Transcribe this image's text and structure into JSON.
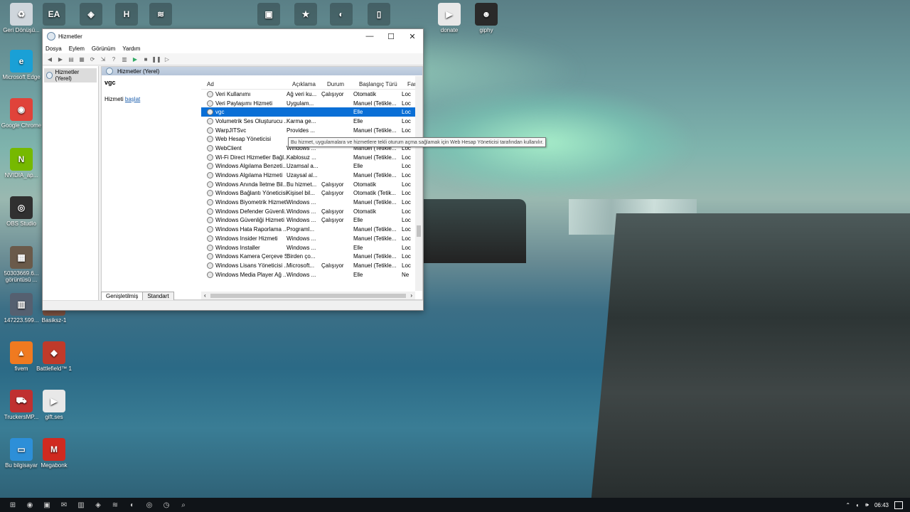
{
  "desktop": {
    "icons": [
      {
        "label": "Geri Dönüşü...",
        "glyph": "♻",
        "color": "#cfd6dc"
      },
      {
        "label": "Microsoft Edge",
        "glyph": "e",
        "color": "#1aa0d6"
      },
      {
        "label": "Google Chrome",
        "glyph": "◉",
        "color": "#e0433a"
      },
      {
        "label": "NVIDIA_ap...",
        "glyph": "N",
        "color": "#76b900"
      },
      {
        "label": "OBS Studio",
        "glyph": "◎",
        "color": "#303030"
      },
      {
        "label": "50303669.6... görüntüsü ...",
        "glyph": "▦",
        "color": "#6a5a4a"
      },
      {
        "label": "147223.599...",
        "glyph": "▥",
        "color": "#556070"
      },
      {
        "label": "fivem",
        "glyph": "▲",
        "color": "#f07a20"
      },
      {
        "label": "TruckersMP...",
        "glyph": "⛟",
        "color": "#c03030"
      },
      {
        "label": "Bu bilgisayar",
        "glyph": "▭",
        "color": "#2d8fd8"
      },
      {
        "label": "Basiksz-1",
        "glyph": "▣",
        "color": "#7a5040"
      },
      {
        "label": "Battlefield™ 1",
        "glyph": "◆",
        "color": "#c03a2a"
      },
      {
        "label": "gift.ses",
        "glyph": "▶",
        "color": "#e8e8e8"
      },
      {
        "label": "Megabonk",
        "glyph": "M",
        "color": "#d02a20"
      },
      {
        "label": "donate",
        "glyph": "▶",
        "color": "#e8e8e8"
      },
      {
        "label": "giphy",
        "glyph": "☻",
        "color": "#2a2a2a"
      }
    ],
    "top_icons": [
      "EA",
      "◈",
      "H",
      "≋",
      "▣",
      "★",
      "◐",
      "▯"
    ]
  },
  "window": {
    "title": "Hizmetler",
    "controls": {
      "minimize": "—",
      "maximize": "☐",
      "close": "✕"
    },
    "menu": [
      "Dosya",
      "Eylem",
      "Görünüm",
      "Yardım"
    ],
    "tree_item": "Hizmetler (Yerel)",
    "pane_header": "Hizmetler (Yerel)",
    "selected_service": "vgc",
    "action_prefix": "Hizmeti ",
    "action_link": "başlat",
    "columns": [
      "Ad",
      "Açıklama",
      "Durum",
      "Başlangıç Türü",
      "Far"
    ],
    "rows": [
      {
        "name": "Veri Kullanımı",
        "desc": "Ağ veri ku...",
        "status": "Çalışıyor",
        "start": "Otomatik",
        "logon": "Loc"
      },
      {
        "name": "Veri Paylaşımı Hizmeti",
        "desc": "Uygulam...",
        "status": "",
        "start": "Manuel (Tetikle...",
        "logon": "Loc"
      },
      {
        "name": "vgc",
        "desc": "",
        "status": "",
        "start": "Elle",
        "logon": "Loc",
        "selected": true
      },
      {
        "name": "Volumetrik Ses Oluşturucu ...",
        "desc": "Karma ge...",
        "status": "",
        "start": "Elle",
        "logon": "Loc"
      },
      {
        "name": "WarpJITSvc",
        "desc": "Provides ...",
        "status": "",
        "start": "Manuel (Tetikle...",
        "logon": "Loc"
      },
      {
        "name": "Web Hesap Yöneticisi",
        "desc": "",
        "status": "",
        "start": "",
        "logon": ""
      },
      {
        "name": "WebClient",
        "desc": "Windows ...",
        "status": "",
        "start": "Manuel (Tetikle...",
        "logon": "Loc"
      },
      {
        "name": "Wi-Fi Direct Hizmetler Bağl...",
        "desc": "Kablosuz ...",
        "status": "",
        "start": "Manuel (Tetikle...",
        "logon": "Loc"
      },
      {
        "name": "Windows Algılama Benzeti...",
        "desc": "Uzamsal a...",
        "status": "",
        "start": "Elle",
        "logon": "Loc"
      },
      {
        "name": "Windows Algılama Hizmeti",
        "desc": "Uzaysal al...",
        "status": "",
        "start": "Manuel (Tetikle...",
        "logon": "Loc"
      },
      {
        "name": "Windows Anında İletme Bil...",
        "desc": "Bu hizmet...",
        "status": "Çalışıyor",
        "start": "Otomatik",
        "logon": "Loc"
      },
      {
        "name": "Windows Bağlantı Yöneticisi",
        "desc": "Kişisel bil...",
        "status": "Çalışıyor",
        "start": "Otomatik (Tetik...",
        "logon": "Loc"
      },
      {
        "name": "Windows Biyometrik Hizmeti",
        "desc": "Windows ...",
        "status": "",
        "start": "Manuel (Tetikle...",
        "logon": "Loc"
      },
      {
        "name": "Windows Defender Güvenli...",
        "desc": "Windows ...",
        "status": "Çalışıyor",
        "start": "Otomatik",
        "logon": "Loc"
      },
      {
        "name": "Windows Güvenliği Hizmeti",
        "desc": "Windows ...",
        "status": "Çalışıyor",
        "start": "Elle",
        "logon": "Loc"
      },
      {
        "name": "Windows Hata Raporlama ...",
        "desc": "Programl...",
        "status": "",
        "start": "Manuel (Tetikle...",
        "logon": "Loc"
      },
      {
        "name": "Windows Insider Hizmeti",
        "desc": "Windows ...",
        "status": "",
        "start": "Manuel (Tetikle...",
        "logon": "Loc"
      },
      {
        "name": "Windows Installer",
        "desc": "Windows ...",
        "status": "",
        "start": "Elle",
        "logon": "Loc"
      },
      {
        "name": "Windows Kamera Çerçeve S...",
        "desc": "Birden ço...",
        "status": "",
        "start": "Manuel (Tetikle...",
        "logon": "Loc"
      },
      {
        "name": "Windows Lisans Yöneticisi ...",
        "desc": "Microsoft...",
        "status": "Çalışıyor",
        "start": "Manuel (Tetikle...",
        "logon": "Loc"
      },
      {
        "name": "Windows Media Player Ağ ...",
        "desc": "Windows ...",
        "status": "",
        "start": "Elle",
        "logon": "Ne"
      }
    ],
    "tabs": [
      "Genişletilmiş",
      "Standart"
    ],
    "tooltip": "Bu hizmet, uygulamalara ve hizmetlere tekli oturum açma sağlamak için Web Hesap Yöneticisi tarafından kullanılır."
  },
  "taskbar": {
    "icons": [
      "⊞",
      "◉",
      "▣",
      "✉",
      "▥",
      "◈",
      "≋",
      "◐",
      "◎",
      "◷",
      "⌕"
    ],
    "time": "06:43",
    "tray": [
      "⌃",
      "◐",
      "🕪"
    ]
  }
}
